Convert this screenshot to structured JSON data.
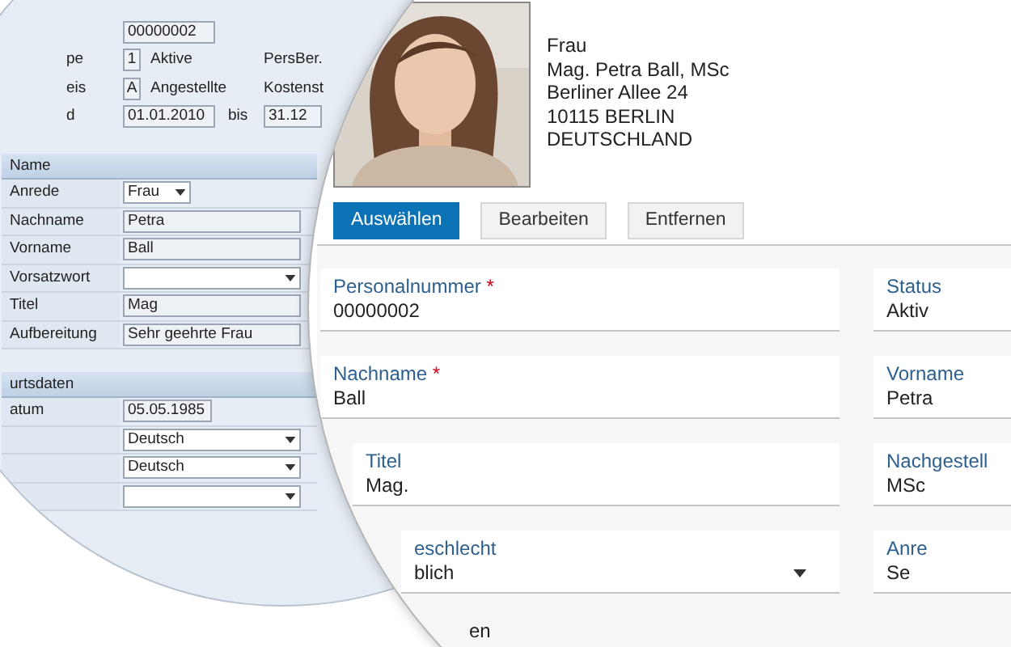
{
  "classic_form": {
    "header_rows": [
      {
        "field": "00000002"
      },
      {
        "label": "pe",
        "code": "1",
        "text": "Aktive",
        "extra_label": "PersBer."
      },
      {
        "label": "eis",
        "code": "A",
        "text": "Angestellte",
        "extra_label": "Kostenst"
      },
      {
        "label": "d",
        "field": "01.01.2010",
        "between": "bis",
        "field_2": "31.12"
      }
    ],
    "sections": [
      {
        "title": "Name",
        "rows": [
          {
            "label": "Anrede",
            "kind": "short_dropdown",
            "value": "Frau"
          },
          {
            "label": "Nachname",
            "kind": "text",
            "value": "Petra"
          },
          {
            "label": "Vorname",
            "kind": "text",
            "value": "Ball"
          },
          {
            "label": "Vorsatzwort",
            "kind": "dropdown"
          },
          {
            "label": "Titel",
            "kind": "text",
            "value": "Mag"
          },
          {
            "label": "Aufbereitung",
            "kind": "text",
            "value": "Sehr geehrte Frau"
          }
        ]
      },
      {
        "title": "urtsdaten",
        "rows": [
          {
            "label": "atum",
            "kind": "short_text",
            "value": "05.05.1985"
          },
          {
            "kind": "dropdown",
            "value": "Deutsch"
          },
          {
            "kind": "dropdown",
            "value": "Deutsch"
          },
          {
            "kind": "dropdown"
          }
        ]
      }
    ]
  },
  "person": {
    "photo": {
      "kind": "picture"
    },
    "address_lines": [
      "Frau",
      "Mag. Petra Ball, MSc",
      "Berliner Allee 24",
      "10115 BERLIN",
      "DEUTSCHLAND"
    ]
  },
  "actions": [
    {
      "label": "Auswählen",
      "kind": "primary"
    },
    {
      "label": "Bearbeiten",
      "kind": "secondary"
    },
    {
      "label": "Entfernen",
      "kind": "secondary"
    }
  ],
  "fields": [
    {
      "label": "Personalnummer",
      "required_mark": "*",
      "value": "00000002",
      "kind": "text"
    },
    {
      "label": "Status",
      "value": "Aktiv",
      "kind": "text"
    },
    {
      "label": "Nachname",
      "required_mark": "*",
      "value": "Ball",
      "kind": "text"
    },
    {
      "label": "Vorname",
      "value": "Petra",
      "kind": "text"
    },
    {
      "label": "Titel",
      "value": "Mag.",
      "kind": "text"
    },
    {
      "label": "Nachgestell",
      "value": "MSc",
      "kind": "text"
    },
    {
      "label": "eschlecht",
      "value": "blich",
      "kind": "dropdown"
    },
    {
      "label": "Anre",
      "value": "Se",
      "kind": "text"
    }
  ],
  "section_footer": "en"
}
